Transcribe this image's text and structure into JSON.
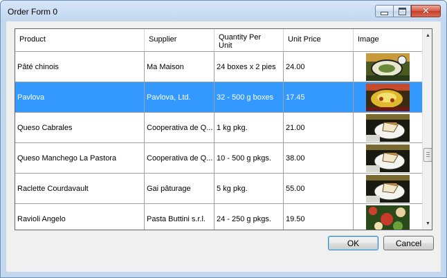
{
  "window": {
    "title": "Order Form 0"
  },
  "titlebar": {
    "min_icon": "minimize-icon",
    "max_icon": "maximize-icon",
    "close_icon": "close-icon"
  },
  "grid": {
    "columns": [
      "Product",
      "Supplier",
      "Quantity Per Unit",
      "Unit Price",
      "Image"
    ],
    "rows": [
      {
        "product": "Pâté chinois",
        "supplier": "Ma Maison",
        "qty": "24 boxes x 2 pies",
        "price": "24.00",
        "image": "dish-photo",
        "selected": false
      },
      {
        "product": "Pavlova",
        "supplier": "Pavlova, Ltd.",
        "qty": "32 - 500 g boxes",
        "price": "17.45",
        "image": "dessert-photo",
        "selected": true
      },
      {
        "product": "Queso Cabrales",
        "supplier": "Cooperativa de Q...",
        "qty": "1 kg pkg.",
        "price": "21.00",
        "image": "cheese-photo",
        "selected": false
      },
      {
        "product": "Queso Manchego La Pastora",
        "supplier": "Cooperativa de Q...",
        "qty": "10 - 500 g pkgs.",
        "price": "38.00",
        "image": "cheese-photo",
        "selected": false
      },
      {
        "product": "Raclette Courdavault",
        "supplier": "Gai pâturage",
        "qty": "5 kg pkg.",
        "price": "55.00",
        "image": "cheese-photo",
        "selected": false
      },
      {
        "product": "Ravioli Angelo",
        "supplier": "Pasta Buttini s.r.l.",
        "qty": "24 - 250 g pkgs.",
        "price": "19.50",
        "image": "pasta-photo",
        "selected": false
      }
    ]
  },
  "buttons": {
    "ok": "OK",
    "cancel": "Cancel"
  },
  "colors": {
    "selection": "#3399ff",
    "titlebar": "#c3d8ef",
    "close": "#c53d2a"
  }
}
